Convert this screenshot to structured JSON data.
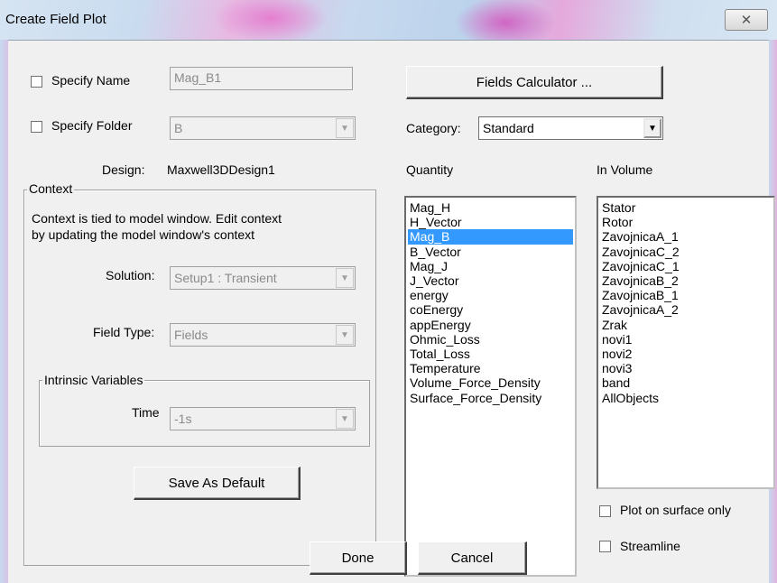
{
  "window": {
    "title": "Create Field Plot",
    "close_glyph": "✕"
  },
  "specify_name": {
    "label": "Specify Name",
    "checked": false,
    "value": "Mag_B1"
  },
  "specify_folder": {
    "label": "Specify Folder",
    "checked": false,
    "value": "B"
  },
  "design": {
    "label": "Design:",
    "value": "Maxwell3DDesign1"
  },
  "context": {
    "group_title": "Context",
    "info_line1": "Context is tied to model window. Edit context",
    "info_line2": "by updating the model window's context",
    "solution_label": "Solution:",
    "solution_value": "Setup1 : Transient",
    "field_type_label": "Field Type:",
    "field_type_value": "Fields",
    "intrinsic_title": "Intrinsic Variables",
    "time_label": "Time",
    "time_value": "-1s",
    "save_default_label": "Save As Default"
  },
  "fields_calculator_label": "Fields Calculator ...",
  "category": {
    "label": "Category:",
    "value": "Standard"
  },
  "quantity": {
    "header": "Quantity",
    "selected": "Mag_B",
    "items": [
      "Mag_H",
      "H_Vector",
      "Mag_B",
      "B_Vector",
      "Mag_J",
      "J_Vector",
      "energy",
      "coEnergy",
      "appEnergy",
      "Ohmic_Loss",
      "Total_Loss",
      "Temperature",
      "Volume_Force_Density",
      "Surface_Force_Density"
    ]
  },
  "in_volume": {
    "header": "In Volume",
    "items": [
      "Stator",
      "Rotor",
      "ZavojnicaA_1",
      "ZavojnicaC_2",
      "ZavojnicaC_1",
      "ZavojnicaB_2",
      "ZavojnicaB_1",
      "ZavojnicaA_2",
      "Zrak",
      "novi1",
      "novi2",
      "novi3",
      "band",
      "AllObjects"
    ]
  },
  "plot_on_surface_only": {
    "label": "Plot on surface only",
    "checked": false
  },
  "streamline": {
    "label": "Streamline",
    "checked": false
  },
  "done_label": "Done",
  "cancel_label": "Cancel",
  "icons": {
    "dropdown_arrow": "▼"
  }
}
